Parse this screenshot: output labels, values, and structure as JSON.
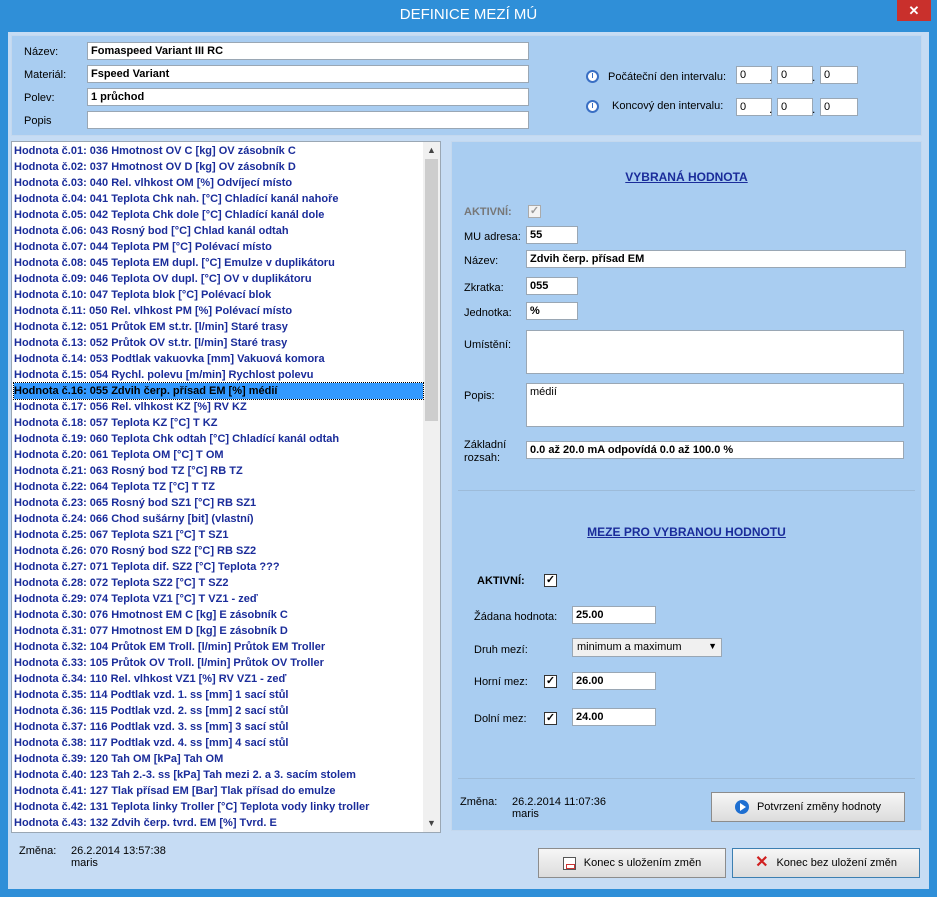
{
  "window": {
    "title": "DEFINICE MEZÍ MÚ",
    "close": "✕"
  },
  "header": {
    "nazev_label": "Název:",
    "nazev_value": "Fomaspeed Variant III RC",
    "material_label": "Materiál:",
    "material_value": "Fspeed Variant",
    "polev_label": "Polev:",
    "polev_value": "1 průchod",
    "popis_label": "Popis",
    "popis_value": "",
    "start_label": "Počáteční den intervalu:",
    "start": [
      "0",
      "0",
      "0"
    ],
    "end_label": "Koncový den intervalu:",
    "end": [
      "0",
      "0",
      "0"
    ],
    "dot": "."
  },
  "list": {
    "selected_index": 15,
    "items": [
      "Hodnota č.01: 036 Hmotnost OV C [kg]  OV zásobník C",
      "Hodnota č.02: 037 Hmotnost OV D [kg]  OV zásobník D",
      "Hodnota č.03: 040 Rel. vlhkost OM [%]  Odvíjecí místo",
      "Hodnota č.04: 041 Teplota Chk nah. [°C]  Chladící kanál nahoře",
      "Hodnota č.05: 042 Teplota Chk dole [°C]  Chladící kanál dole",
      "Hodnota č.06: 043 Rosný bod [°C]  Chlad kanál odtah",
      "Hodnota č.07: 044 Teplota PM [°C]  Polévací místo",
      "Hodnota č.08: 045 Teplota EM dupl. [°C]  Emulze v duplikátoru",
      "Hodnota č.09: 046 Teplota OV dupl. [°C]  OV v duplikátoru",
      "Hodnota č.10: 047 Teplota blok [°C]  Polévací blok",
      "Hodnota č.11: 050 Rel. vlhkost PM [%]  Polévací místo",
      "Hodnota č.12: 051 Průtok EM st.tr. [l/min]  Staré trasy",
      "Hodnota č.13: 052 Průtok OV st.tr. [l/min]  Staré trasy",
      "Hodnota č.14: 053 Podtlak vakuovka [mm]  Vakuová komora",
      "Hodnota č.15: 054 Rychl. polevu [m/min]  Rychlost polevu",
      "Hodnota č.16: 055 Zdvih čerp. přísad EM [%]  médií",
      "Hodnota č.17: 056 Rel. vlhkost KZ [%]  RV KZ",
      "Hodnota č.18: 057 Teplota KZ [°C]  T KZ",
      "Hodnota č.19: 060 Teplota Chk odtah [°C]  Chladící kanál odtah",
      "Hodnota č.20: 061 Teplota OM [°C]  T OM",
      "Hodnota č.21: 063 Rosný bod TZ [°C]  RB TZ",
      "Hodnota č.22: 064 Teplota TZ [°C]  T TZ",
      "Hodnota č.23: 065 Rosný bod SZ1 [°C]  RB SZ1",
      "Hodnota č.24: 066 Chod sušárny [bit]  (vlastní)",
      "Hodnota č.25: 067 Teplota SZ1 [°C]  T SZ1",
      "Hodnota č.26: 070 Rosný bod SZ2 [°C]  RB SZ2",
      "Hodnota č.27: 071 Teplota dif. SZ2 [°C]  Teplota ???",
      "Hodnota č.28: 072 Teplota SZ2 [°C]  T SZ2",
      "Hodnota č.29: 074 Teplota VZ1 [°C]  T VZ1 - zeď",
      "Hodnota č.30: 076 Hmotnost EM C [kg]  E zásobník C",
      "Hodnota č.31: 077 Hmotnost EM D [kg]  E zásobník D",
      "Hodnota č.32: 104 Průtok EM Troll. [l/min]  Průtok EM Troller",
      "Hodnota č.33: 105 Průtok OV Troll. [l/min]  Průtok OV Troller",
      "Hodnota č.34: 110 Rel. vlhkost VZ1 [%]  RV VZ1 - zeď",
      "Hodnota č.35: 114 Podtlak vzd. 1. ss [mm]  1 sací stůl",
      "Hodnota č.36: 115 Podtlak vzd. 2. ss [mm]  2 sací stůl",
      "Hodnota č.37: 116 Podtlak vzd. 3. ss [mm]  3 sací stůl",
      "Hodnota č.38: 117 Podtlak vzd. 4. ss [mm]  4 sací stůl",
      "Hodnota č.39: 120 Tah OM [kPa]  Tah OM",
      "Hodnota č.40: 123 Tah 2.-3. ss [kPa]  Tah mezi 2. a 3. sacím stolem",
      "Hodnota č.41: 127 Tlak přísad EM [Bar]  Tlak přísad do emulze",
      "Hodnota č.42: 131 Teplota linky Troller [°C]  Teplota vody linky troller",
      "Hodnota č.43: 132 Zdvih čerp. tvrd. EM [%]  Tvrd. E"
    ],
    "change_label": "Změna:",
    "change_date": "26.2.2014  13:57:38",
    "change_user": "maris"
  },
  "detail": {
    "heading": "VYBRANÁ HODNOTA",
    "aktivni_label": "AKTIVNÍ:",
    "mu_adresa_label": "MU adresa:",
    "mu_adresa": "55",
    "nazev_label": "Název:",
    "nazev": "Zdvih čerp. přísad EM",
    "zkratka_label": "Zkratka:",
    "zkratka": "055",
    "jednotka_label": "Jednotka:",
    "jednotka": "%",
    "umisteni_label": "Umístění:",
    "umisteni": "",
    "popis_label": "Popis:",
    "popis": "médií",
    "rozsah_label_1": "Základní",
    "rozsah_label_2": "rozsah:",
    "rozsah": "0.0 až 20.0 mA odpovídá 0.0 až 100.0 %"
  },
  "limits": {
    "heading": "MEZE PRO VYBRANOU HODNOTU",
    "aktivni_label": "AKTIVNÍ:",
    "zadana_label": "Žádana hodnota:",
    "zadana": "25.00",
    "druh_label": "Druh mezí:",
    "druh": "minimum a maximum",
    "horni_label": "Horní mez:",
    "horni": "26.00",
    "dolni_label": "Dolní mez:",
    "dolni": "24.00",
    "check": "✓"
  },
  "footer": {
    "change_label": "Změna:",
    "change_date": "26.2.2014  11:07:36",
    "change_user": "maris",
    "confirm_button": "Potvrzení změny hodnoty",
    "save_button": "Konec s uložením změn",
    "nosave_button": "Konec bez uložení změn"
  }
}
